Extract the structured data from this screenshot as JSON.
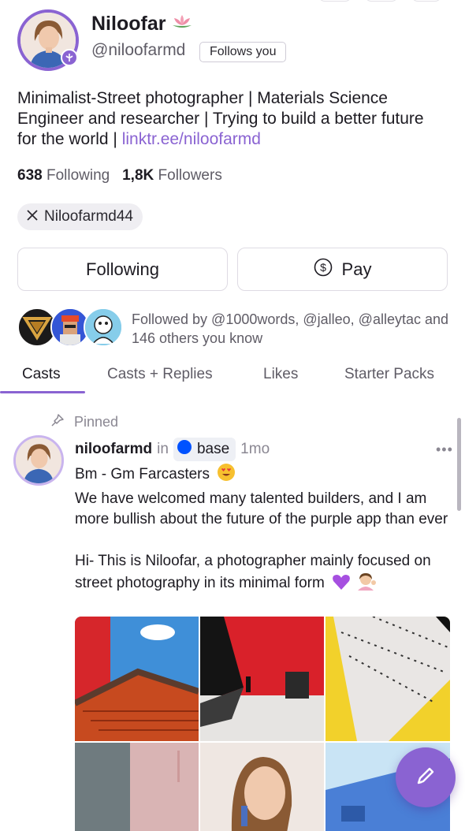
{
  "profile": {
    "display_name": "Niloofar",
    "name_emoji_icon": "lotus-icon",
    "handle": "@niloofarmd",
    "follows_you_label": "Follows you",
    "bio_text": "Minimalist-Street photographer | Materials Science Engineer and researcher | Trying to build a better future for the world | ",
    "bio_link": "linktr.ee/niloofarmd",
    "following_count": "638",
    "following_label": "Following",
    "followers_count": "1,8K",
    "followers_label": "Followers",
    "x_account": "Niloofarmd44"
  },
  "actions": {
    "following_button": "Following",
    "pay_button": "Pay"
  },
  "followed_by": {
    "text": "Followed by @1000words, @jalleo, @alleytac and 146 others you know"
  },
  "tabs": [
    {
      "label": "Casts",
      "active": true
    },
    {
      "label": "Casts + Replies",
      "active": false
    },
    {
      "label": "Likes",
      "active": false
    },
    {
      "label": "Starter Packs",
      "active": false
    }
  ],
  "pinned_cast": {
    "pinned_label": "Pinned",
    "author": "niloofarmd",
    "in_label": "in",
    "channel": "base",
    "time": "1mo",
    "more_label": "•••",
    "line1": "Bm - Gm Farcasters",
    "line2": "We have welcomed many talented builders, and I am more bullish about the future of the purple app than ever",
    "line3": "Hi- This is Niloofar, a photographer mainly focused on street photography in its minimal form",
    "emojis": [
      "heart-eyes-emoji",
      "purple-heart-emoji",
      "woman-tipping-hand-emoji"
    ]
  },
  "colors": {
    "accent": "#8a63d2",
    "base_blue": "#0052ff",
    "muted_text": "#5f5c66"
  }
}
